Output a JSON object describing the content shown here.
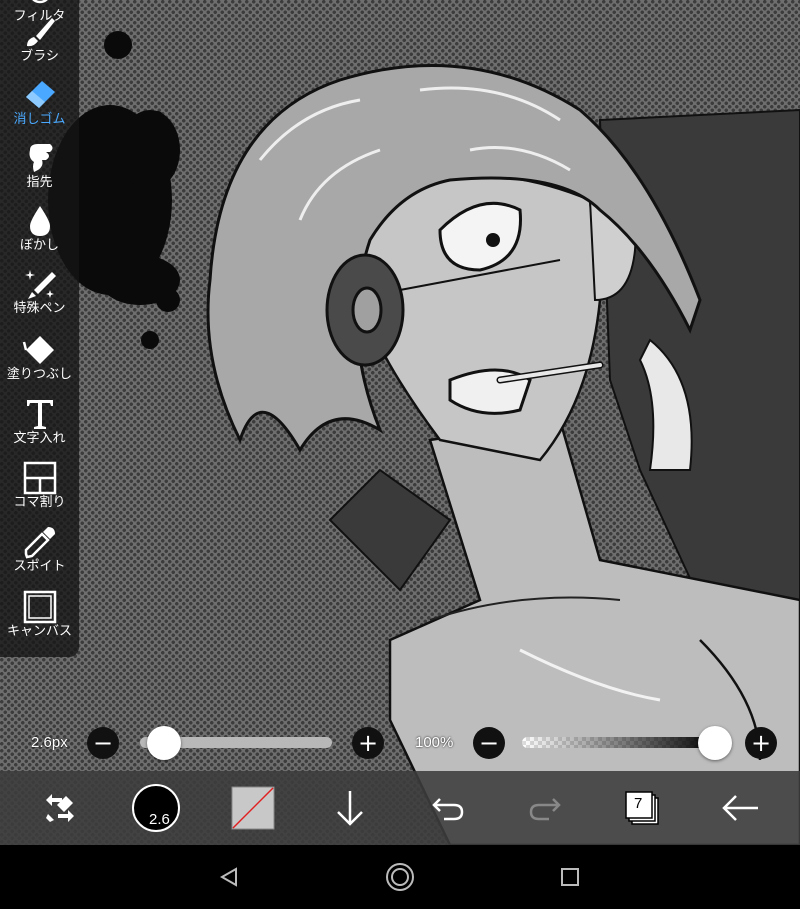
{
  "tools": [
    {
      "id": "filter",
      "label": "フィルタ",
      "icon": "filter-icon"
    },
    {
      "id": "brush",
      "label": "ブラシ",
      "icon": "brush-icon"
    },
    {
      "id": "eraser",
      "label": "消しゴム",
      "icon": "eraser-icon",
      "active": true
    },
    {
      "id": "finger",
      "label": "指先",
      "icon": "finger-icon"
    },
    {
      "id": "blur",
      "label": "ぼかし",
      "icon": "blur-drop-icon"
    },
    {
      "id": "special-pen",
      "label": "特殊ペン",
      "icon": "special-pen-icon"
    },
    {
      "id": "fill",
      "label": "塗りつぶし",
      "icon": "fill-bucket-icon"
    },
    {
      "id": "text",
      "label": "文字入れ",
      "icon": "text-t-icon"
    },
    {
      "id": "panel",
      "label": "コマ割り",
      "icon": "panel-divide-icon"
    },
    {
      "id": "eyedropper",
      "label": "スポイト",
      "icon": "eyedropper-icon"
    },
    {
      "id": "canvas",
      "label": "キャンバス",
      "icon": "canvas-frame-icon"
    }
  ],
  "brush_size": {
    "label": "2.6px",
    "minus": "−",
    "plus": "+",
    "value_fraction": 0.02
  },
  "opacity": {
    "label": "100%",
    "minus": "−",
    "plus": "+",
    "value_fraction": 1.0
  },
  "toolbar": {
    "brush_size_badge": "2.6",
    "layer_count": "7",
    "icons": [
      "swap-tool-icon",
      "brush-size-icon",
      "color-swatch-icon",
      "download-arrow-icon",
      "undo-icon",
      "redo-icon",
      "layers-icon",
      "back-arrow-icon"
    ]
  },
  "nav": {
    "icons": [
      "nav-back-icon",
      "nav-home-icon",
      "nav-recents-icon"
    ]
  },
  "colors": {
    "accent": "#4aa9ff",
    "panel": "#141414",
    "toolbar": "#3c3c3c",
    "color_swatch": "#c8c8c8",
    "swatch_slash": "#e02020"
  }
}
